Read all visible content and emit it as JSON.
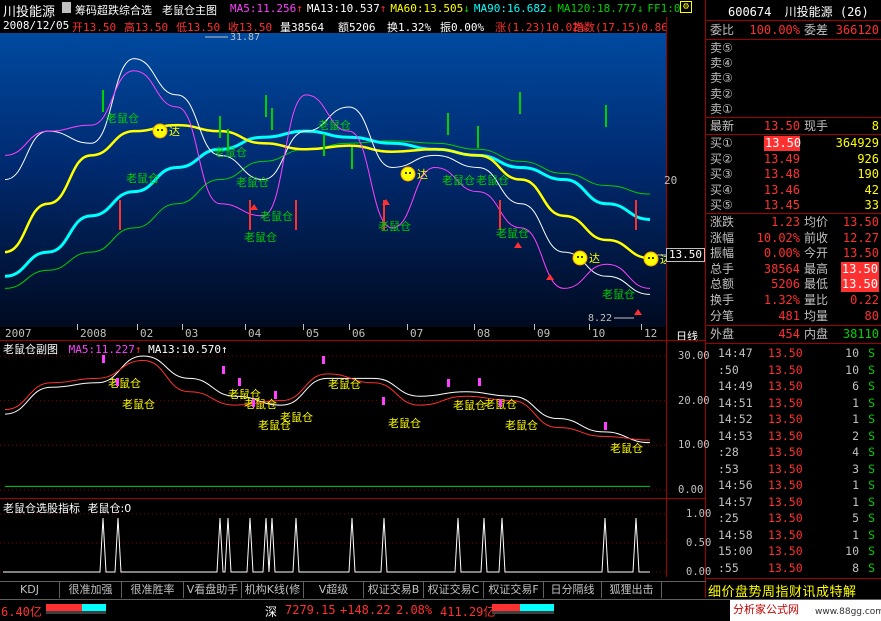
{
  "stock_name": "川投能源",
  "indicator_menu": "筹码超跌综合选",
  "main_title": "老鼠仓主图",
  "ma_line": [
    {
      "label": "MA5:11.256",
      "arrow": "↑",
      "color": "#ff40ff"
    },
    {
      "label": "MA13:10.537",
      "arrow": "↑",
      "color": "#ffffff"
    },
    {
      "label": "MA60:13.505",
      "arrow": "↓",
      "color": "#ffff00"
    },
    {
      "label": "MA90:16.682",
      "arrow": "↓",
      "color": "#00ffff"
    },
    {
      "label": "MA120:18.777",
      "arrow": "↓",
      "color": "#00d000"
    },
    {
      "label": "FF1:0",
      "arrow": "",
      "color": "#00d000"
    }
  ],
  "info_line": {
    "date": "2008/12/05",
    "open": "开13.50",
    "high": "高13.50",
    "low": "低13.50",
    "close": "收13.50",
    "volume": "量38564",
    "amount": "额5206",
    "turnover": "换1.32%",
    "amplitude": "振0.00%",
    "change": "涨(1.23)10.02%",
    "index": "指数(17.15)0.86"
  },
  "main_chart": {
    "high_label": "31.87",
    "low_label": "8.22",
    "y_tick": "20",
    "price_tag": "13.50",
    "marker_bubble_text": "达",
    "x_labels": [
      "2007",
      "2008",
      "02",
      "03",
      "04",
      "05",
      "06",
      "07",
      "08",
      "09",
      "10",
      "12"
    ],
    "period": "日线",
    "signal_text": "老鼠仓",
    "signals": [
      [
        128,
        118
      ],
      [
        148,
        178
      ],
      [
        236,
        152
      ],
      [
        258,
        182
      ],
      [
        282,
        216
      ],
      [
        266,
        237
      ],
      [
        400,
        226
      ],
      [
        340,
        125
      ],
      [
        464,
        180
      ],
      [
        498,
        180
      ],
      [
        518,
        233
      ],
      [
        624,
        294
      ]
    ],
    "smile_markers": [
      [
        160,
        131
      ],
      [
        408,
        174
      ],
      [
        580,
        258
      ],
      [
        651,
        259
      ]
    ]
  },
  "sub_chart": {
    "title": "老鼠仓副图",
    "ma5": "MA5:11.227",
    "ma13": "MA13:10.570",
    "ma13_arrow": "↑",
    "y_ticks": [
      "30.00",
      "20.00",
      "10.00",
      "0.00"
    ],
    "signal_text": "老鼠仓",
    "signals": [
      [
        126,
        383
      ],
      [
        140,
        404
      ],
      [
        246,
        394
      ],
      [
        262,
        404
      ],
      [
        276,
        425
      ],
      [
        298,
        417
      ],
      [
        346,
        384
      ],
      [
        406,
        423
      ],
      [
        471,
        405
      ],
      [
        502,
        404
      ],
      [
        523,
        425
      ],
      [
        628,
        448
      ]
    ]
  },
  "select_chart": {
    "title": "老鼠仓选股指标",
    "value_label": "老鼠仓:0",
    "y_ticks": [
      "1.00",
      "0.50",
      "0.00"
    ]
  },
  "bottom_tabs": [
    "KDJ",
    "很准加强",
    "很准胜率",
    "V看盘助手",
    "机构K线(修",
    "V超级MACD",
    "权证交易B",
    "权证交易C",
    "权证交易F",
    "日分隔线",
    "狐狸出击"
  ],
  "quote_panel": {
    "code": "600674",
    "name": "川投能源",
    "count": "(26)",
    "weibi_label": "委比",
    "weibi": "100.00%",
    "weicha_label": "委差",
    "weicha": "366120",
    "sell": [
      {
        "label": "卖⑤",
        "price": "",
        "vol": ""
      },
      {
        "label": "卖④",
        "price": "",
        "vol": ""
      },
      {
        "label": "卖③",
        "price": "",
        "vol": ""
      },
      {
        "label": "卖②",
        "price": "",
        "vol": ""
      },
      {
        "label": "卖①",
        "price": "",
        "vol": ""
      }
    ],
    "latest_label": "最新",
    "latest": "13.50",
    "xianshou_label": "现手",
    "xianshou": "8",
    "buy": [
      {
        "label": "买①",
        "price": "13.50",
        "vol": "364929"
      },
      {
        "label": "买②",
        "price": "13.49",
        "vol": "926"
      },
      {
        "label": "买③",
        "price": "13.48",
        "vol": "190"
      },
      {
        "label": "买④",
        "price": "13.46",
        "vol": "42"
      },
      {
        "label": "买⑤",
        "price": "13.45",
        "vol": "33"
      }
    ],
    "stats": [
      {
        "l1": "涨跌",
        "v1": "1.23",
        "l2": "均价",
        "v2": "13.50",
        "hl2": false
      },
      {
        "l1": "涨幅",
        "v1": "10.02%",
        "l2": "前收",
        "v2": "12.27",
        "hl2": false
      },
      {
        "l1": "振幅",
        "v1": "0.00%",
        "l2": "今开",
        "v2": "13.50",
        "hl2": false
      },
      {
        "l1": "总手",
        "v1": "38564",
        "l2": "最高",
        "v2": "13.50",
        "hl2": true
      },
      {
        "l1": "总额",
        "v1": "5206",
        "l2": "最低",
        "v2": "13.50",
        "hl2": true
      },
      {
        "l1": "换手",
        "v1": "1.32%",
        "l2": "量比",
        "v2": "0.22",
        "hl2": false
      },
      {
        "l1": "分笔",
        "v1": "481",
        "l2": "均量",
        "v2": "80",
        "hl2": false
      }
    ],
    "waipan_label": "外盘",
    "waipan": "454",
    "neipan_label": "内盘",
    "neipan": "38110"
  },
  "ticks": [
    {
      "time": "14:47",
      "price": "13.50",
      "vol": "10",
      "side": "S"
    },
    {
      "time": ":50",
      "price": "13.50",
      "vol": "10",
      "side": "S"
    },
    {
      "time": "14:49",
      "price": "13.50",
      "vol": "6",
      "side": "S"
    },
    {
      "time": "14:51",
      "price": "13.50",
      "vol": "1",
      "side": "S"
    },
    {
      "time": "14:52",
      "price": "13.50",
      "vol": "1",
      "side": "S"
    },
    {
      "time": "14:53",
      "price": "13.50",
      "vol": "2",
      "side": "S"
    },
    {
      "time": ":28",
      "price": "13.50",
      "vol": "4",
      "side": "S"
    },
    {
      "time": ":53",
      "price": "13.50",
      "vol": "3",
      "side": "S"
    },
    {
      "time": "14:56",
      "price": "13.50",
      "vol": "1",
      "side": "S"
    },
    {
      "time": "14:57",
      "price": "13.50",
      "vol": "1",
      "side": "S"
    },
    {
      "time": ":25",
      "price": "13.50",
      "vol": "5",
      "side": "S"
    },
    {
      "time": "14:58",
      "price": "13.50",
      "vol": "1",
      "side": "S"
    },
    {
      "time": "15:00",
      "price": "13.50",
      "vol": "10",
      "side": "S"
    },
    {
      "time": ":55",
      "price": "13.50",
      "vol": "8",
      "side": "S"
    }
  ],
  "right_tabs": "细价盘势周指财讯成特解",
  "status_bar": {
    "left_value": "6.40亿",
    "market": "深",
    "index_value": "7279.15",
    "index_change": "+148.22",
    "index_pct": "2.08%",
    "turnover": "411.29亿",
    "watermark": "分析家公式网",
    "watermark_url": "www.88gg.com"
  },
  "colors": {
    "up": "#ff3030",
    "down": "#00d000",
    "ma5": "#ff40ff",
    "ma13": "#ffffff",
    "ma60": "#ffff00",
    "ma90": "#00ffff",
    "ma120": "#00d000",
    "grid": "#a00000"
  },
  "chart_data": [
    {
      "type": "line",
      "title": "老鼠仓主图",
      "categories": [
        "2007",
        "2008",
        "02",
        "03",
        "04",
        "05",
        "06",
        "07",
        "08",
        "09",
        "10",
        "12"
      ],
      "series": [
        {
          "name": "MA5",
          "values": [
            22,
            24,
            24.5,
            29,
            26,
            18,
            17,
            27,
            24,
            16,
            21,
            19,
            16,
            11,
            13,
            11
          ]
        },
        {
          "name": "MA13",
          "values": [
            20,
            24,
            23,
            30,
            27,
            22,
            20,
            24,
            26,
            21,
            22,
            21,
            18,
            14,
            12,
            10.5
          ]
        },
        {
          "name": "MA60",
          "values": [
            14,
            18,
            22,
            24,
            24.5,
            24,
            23,
            22.5,
            22.8,
            22.3,
            22.5,
            22,
            20,
            17,
            15,
            13.5
          ]
        },
        {
          "name": "MA90",
          "values": [
            12,
            14,
            17,
            19,
            21,
            22.5,
            23.5,
            24,
            23.5,
            23,
            22.5,
            22,
            21,
            20,
            18,
            16.7
          ]
        },
        {
          "name": "MA120",
          "values": [
            11,
            12.5,
            14,
            16,
            18,
            20,
            21.5,
            22.5,
            23,
            23.2,
            23,
            22.5,
            21.5,
            20.5,
            19.5,
            18.8
          ]
        }
      ],
      "ylim": [
        8.22,
        31.87
      ],
      "annotations": [
        "31.87",
        "8.22",
        "老鼠仓",
        "达"
      ]
    },
    {
      "type": "line",
      "title": "老鼠仓副图",
      "series": [
        {
          "name": "MA5",
          "values": [
            18,
            24,
            25,
            29,
            22,
            19,
            20,
            26,
            24,
            19,
            21,
            20,
            14,
            12,
            11.2
          ]
        },
        {
          "name": "MA13",
          "values": [
            17,
            23,
            24,
            30,
            25,
            21,
            19,
            25,
            25,
            21,
            22,
            21,
            16,
            13,
            10.6
          ]
        }
      ],
      "ylim": [
        0,
        30
      ]
    },
    {
      "type": "bar",
      "title": "老鼠仓选股指标",
      "ylim": [
        0,
        1
      ],
      "values_note_positions": [
        103,
        118,
        220,
        228,
        250,
        266,
        272,
        296,
        352,
        384,
        458,
        484,
        502,
        605,
        636
      ]
    }
  ]
}
